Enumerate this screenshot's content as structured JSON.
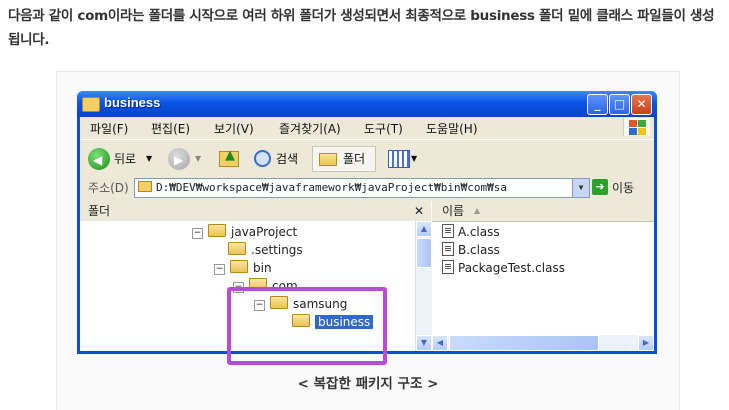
{
  "intro_text": "다음과 같이 com이라는 폴더를 시작으로 여러 하위 폴더가 생성되면서 최종적으로 business 폴더 밑에 클래스 파일들이 생성됩니다.",
  "caption": "< 복잡한 패키지 구조 >",
  "window": {
    "title": "business",
    "buttons": {
      "minimize": "_",
      "maximize": "□",
      "close": "✕"
    }
  },
  "menu": [
    "파일(F)",
    "편집(E)",
    "보기(V)",
    "즐겨찾기(A)",
    "도구(T)",
    "도움말(H)"
  ],
  "toolbar": {
    "back": "뒤로",
    "search": "검색",
    "folders": "폴더"
  },
  "address": {
    "label": "주소(D)",
    "value": "D:₩DEV₩workspace₩javaframework₩javaProject₩bin₩com₩sa",
    "go": "이동"
  },
  "folder_pane": {
    "header": "폴더",
    "close": "✕",
    "tree": [
      {
        "label": "javaProject",
        "expander": "⊟"
      },
      {
        "label": ".settings",
        "expander": ""
      },
      {
        "label": "bin",
        "expander": "⊟"
      },
      {
        "label": "com",
        "expander": "⊟"
      },
      {
        "label": "samsung",
        "expander": "⊟"
      },
      {
        "label": "business",
        "expander": "",
        "selected": true
      }
    ]
  },
  "file_pane": {
    "header": "이름",
    "sort_indicator": "▲",
    "files": [
      "A.class",
      "B.class",
      "PackageTest.class"
    ]
  },
  "colors": {
    "titlebar": "#0a55e6",
    "highlight_box": "#b84bdc",
    "selection": "#316ac5"
  }
}
